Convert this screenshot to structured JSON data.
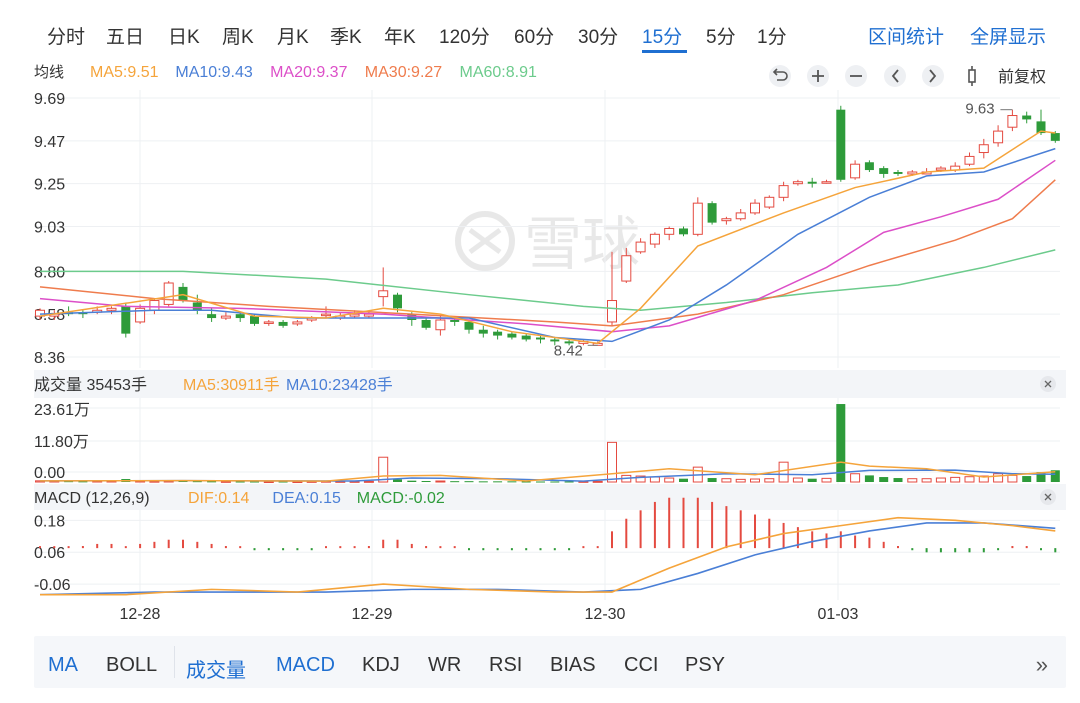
{
  "period_tabs": [
    {
      "label": "分时"
    },
    {
      "label": "五日"
    },
    {
      "label": "日K"
    },
    {
      "label": "周K"
    },
    {
      "label": "月K"
    },
    {
      "label": "季K"
    },
    {
      "label": "年K"
    },
    {
      "label": "120分"
    },
    {
      "label": "60分"
    },
    {
      "label": "30分"
    },
    {
      "label": "15分",
      "active": true
    },
    {
      "label": "5分"
    },
    {
      "label": "1分"
    }
  ],
  "actions": {
    "range_stats": "区间统计",
    "fullscreen": "全屏显示"
  },
  "toolbar": {
    "icons": [
      "undo-icon",
      "zoom-in-icon",
      "zoom-out-icon",
      "prev-icon",
      "next-icon",
      "candle-icon"
    ],
    "adjust_label": "前复权"
  },
  "colors": {
    "up": "#e44a40",
    "down": "#2e9b3a",
    "ma5": "#f5a43b",
    "ma10": "#4a7fd6",
    "ma20": "#dc4fc8",
    "ma30": "#ef7c4d",
    "ma60": "#6ccb8c",
    "accent": "#1f6fd1"
  },
  "chart_data": [
    {
      "type": "candlestick",
      "legend_title": "均线",
      "ma_labels": [
        {
          "text": "MA5:9.51",
          "color": "ma5"
        },
        {
          "text": "MA10:9.43",
          "color": "ma10"
        },
        {
          "text": "MA20:9.37",
          "color": "ma20"
        },
        {
          "text": "MA30:9.27",
          "color": "ma30"
        },
        {
          "text": "MA60:8.91",
          "color": "ma60"
        }
      ],
      "y_ticks": [
        "9.69",
        "9.47",
        "9.25",
        "9.03",
        "8.80",
        "8.58",
        "8.36"
      ],
      "ylim": [
        8.36,
        9.69
      ],
      "x_ticks": [
        "12-28",
        "12-29",
        "12-30",
        "01-03"
      ],
      "high_label": "9.63",
      "low_label": "8.42",
      "candles": [
        [
          8.57,
          8.6,
          8.61,
          8.55
        ],
        [
          8.57,
          8.58,
          8.6,
          8.55
        ],
        [
          8.59,
          8.58,
          8.62,
          8.57
        ],
        [
          8.59,
          8.58,
          8.6,
          8.56
        ],
        [
          8.59,
          8.6,
          8.62,
          8.58
        ],
        [
          8.6,
          8.61,
          8.62,
          8.58
        ],
        [
          8.62,
          8.48,
          8.64,
          8.46
        ],
        [
          8.54,
          8.61,
          8.63,
          8.53
        ],
        [
          8.6,
          8.65,
          8.66,
          8.58
        ],
        [
          8.63,
          8.74,
          8.75,
          8.62
        ],
        [
          8.72,
          8.65,
          8.74,
          8.64
        ],
        [
          8.64,
          8.6,
          8.68,
          8.58
        ],
        [
          8.58,
          8.56,
          8.61,
          8.54
        ],
        [
          8.56,
          8.57,
          8.59,
          8.55
        ],
        [
          8.58,
          8.56,
          8.59,
          8.54
        ],
        [
          8.57,
          8.53,
          8.58,
          8.52
        ],
        [
          8.54,
          8.54,
          8.55,
          8.52
        ],
        [
          8.54,
          8.52,
          8.55,
          8.51
        ],
        [
          8.53,
          8.54,
          8.55,
          8.52
        ],
        [
          8.55,
          8.56,
          8.57,
          8.54
        ],
        [
          8.58,
          8.58,
          8.62,
          8.56
        ],
        [
          8.56,
          8.57,
          8.59,
          8.55
        ],
        [
          8.57,
          8.58,
          8.6,
          8.56
        ],
        [
          8.57,
          8.58,
          8.59,
          8.56
        ],
        [
          8.67,
          8.7,
          8.82,
          8.62
        ],
        [
          8.68,
          8.61,
          8.69,
          8.59
        ],
        [
          8.58,
          8.55,
          8.59,
          8.52
        ],
        [
          8.55,
          8.51,
          8.56,
          8.5
        ],
        [
          8.5,
          8.55,
          8.57,
          8.47
        ],
        [
          8.55,
          8.54,
          8.56,
          8.52
        ],
        [
          8.54,
          8.5,
          8.55,
          8.48
        ],
        [
          8.5,
          8.48,
          8.52,
          8.46
        ],
        [
          8.49,
          8.47,
          8.5,
          8.45
        ],
        [
          8.48,
          8.46,
          8.49,
          8.45
        ],
        [
          8.47,
          8.45,
          8.48,
          8.44
        ],
        [
          8.46,
          8.45,
          8.47,
          8.43
        ],
        [
          8.45,
          8.44,
          8.46,
          8.42
        ],
        [
          8.44,
          8.43,
          8.45,
          8.42
        ],
        [
          8.43,
          8.44,
          8.45,
          8.42
        ],
        [
          8.42,
          8.43,
          8.44,
          8.42
        ],
        [
          8.54,
          8.65,
          8.9,
          8.52
        ],
        [
          8.75,
          8.88,
          8.92,
          8.74
        ],
        [
          8.9,
          8.95,
          8.97,
          8.89
        ],
        [
          8.94,
          8.99,
          9.0,
          8.92
        ],
        [
          8.99,
          9.02,
          9.03,
          8.96
        ],
        [
          9.02,
          8.99,
          9.03,
          8.98
        ],
        [
          8.99,
          9.15,
          9.18,
          8.98
        ],
        [
          9.15,
          9.05,
          9.16,
          9.04
        ],
        [
          9.06,
          9.07,
          9.08,
          9.04
        ],
        [
          9.07,
          9.1,
          9.12,
          9.06
        ],
        [
          9.1,
          9.15,
          9.17,
          9.09
        ],
        [
          9.13,
          9.18,
          9.19,
          9.12
        ],
        [
          9.18,
          9.24,
          9.26,
          9.16
        ],
        [
          9.25,
          9.26,
          9.27,
          9.24
        ],
        [
          9.26,
          9.25,
          9.28,
          9.23
        ],
        [
          9.26,
          9.26,
          9.27,
          9.25
        ],
        [
          9.63,
          9.27,
          9.65,
          9.26
        ],
        [
          9.28,
          9.35,
          9.37,
          9.27
        ],
        [
          9.36,
          9.32,
          9.37,
          9.31
        ],
        [
          9.33,
          9.3,
          9.34,
          9.28
        ],
        [
          9.31,
          9.3,
          9.32,
          9.29
        ],
        [
          9.3,
          9.31,
          9.32,
          9.29
        ],
        [
          9.3,
          9.31,
          9.33,
          9.3
        ],
        [
          9.32,
          9.33,
          9.34,
          9.31
        ],
        [
          9.32,
          9.34,
          9.36,
          9.31
        ],
        [
          9.35,
          9.39,
          9.41,
          9.34
        ],
        [
          9.41,
          9.45,
          9.48,
          9.38
        ],
        [
          9.46,
          9.52,
          9.55,
          9.44
        ],
        [
          9.54,
          9.6,
          9.63,
          9.52
        ],
        [
          9.6,
          9.58,
          9.62,
          9.56
        ],
        [
          9.57,
          9.51,
          9.63,
          9.5
        ],
        [
          9.51,
          9.47,
          9.52,
          9.46
        ]
      ],
      "ma": {
        "ma5": [
          [
            0,
            8.57
          ],
          [
            10,
            8.68
          ],
          [
            15,
            8.57
          ],
          [
            20,
            8.56
          ],
          [
            24,
            8.61
          ],
          [
            28,
            8.58
          ],
          [
            33,
            8.49
          ],
          [
            39,
            8.43
          ],
          [
            42,
            8.61
          ],
          [
            46,
            8.93
          ],
          [
            52,
            9.1
          ],
          [
            57,
            9.23
          ],
          [
            62,
            9.31
          ],
          [
            66,
            9.33
          ],
          [
            70,
            9.52
          ],
          [
            71,
            9.51
          ]
        ],
        "ma10": [
          [
            0,
            8.58
          ],
          [
            8,
            8.6
          ],
          [
            12,
            8.6
          ],
          [
            18,
            8.56
          ],
          [
            24,
            8.56
          ],
          [
            30,
            8.56
          ],
          [
            36,
            8.46
          ],
          [
            40,
            8.44
          ],
          [
            44,
            8.55
          ],
          [
            48,
            8.73
          ],
          [
            53,
            8.99
          ],
          [
            58,
            9.18
          ],
          [
            62,
            9.29
          ],
          [
            66,
            9.31
          ],
          [
            71,
            9.43
          ]
        ],
        "ma20": [
          [
            0,
            8.66
          ],
          [
            6,
            8.62
          ],
          [
            14,
            8.61
          ],
          [
            24,
            8.58
          ],
          [
            34,
            8.53
          ],
          [
            40,
            8.49
          ],
          [
            44,
            8.52
          ],
          [
            50,
            8.65
          ],
          [
            55,
            8.82
          ],
          [
            59,
            9.0
          ],
          [
            63,
            9.08
          ],
          [
            67,
            9.17
          ],
          [
            71,
            9.37
          ]
        ],
        "ma30": [
          [
            0,
            8.72
          ],
          [
            8,
            8.66
          ],
          [
            16,
            8.62
          ],
          [
            26,
            8.58
          ],
          [
            36,
            8.54
          ],
          [
            40,
            8.52
          ],
          [
            46,
            8.58
          ],
          [
            52,
            8.68
          ],
          [
            58,
            8.83
          ],
          [
            64,
            8.96
          ],
          [
            68,
            9.07
          ],
          [
            71,
            9.27
          ]
        ],
        "ma60": [
          [
            0,
            8.8
          ],
          [
            10,
            8.8
          ],
          [
            20,
            8.76
          ],
          [
            30,
            8.68
          ],
          [
            38,
            8.62
          ],
          [
            42,
            8.6
          ],
          [
            48,
            8.64
          ],
          [
            54,
            8.69
          ],
          [
            60,
            8.73
          ],
          [
            66,
            8.82
          ],
          [
            71,
            8.91
          ]
        ]
      }
    },
    {
      "type": "bar",
      "title": "成交量 35453手",
      "ma_labels": [
        {
          "text": "MA5:30911手",
          "color": "ma5"
        },
        {
          "text": "MA10:23428手",
          "color": "ma10"
        }
      ],
      "y_ticks": [
        "23.61万",
        "11.80万",
        "0.00"
      ],
      "ylim": [
        0,
        236100
      ],
      "values": [
        3500,
        4000,
        2500,
        2000,
        3000,
        3500,
        9000,
        3000,
        2500,
        3500,
        3000,
        2500,
        2000,
        2000,
        1500,
        1500,
        1500,
        1500,
        1500,
        2000,
        2500,
        2000,
        2000,
        2000,
        75000,
        8000,
        4000,
        3000,
        3000,
        2500,
        2500,
        2000,
        2000,
        2000,
        1500,
        1500,
        1500,
        1500,
        2000,
        2000,
        120000,
        20000,
        18000,
        15000,
        12000,
        10000,
        45000,
        12000,
        10000,
        8000,
        9000,
        10000,
        60000,
        12000,
        10000,
        11000,
        236000,
        25000,
        20000,
        15000,
        12000,
        10000,
        10000,
        12000,
        14000,
        16000,
        18000,
        25000,
        20000,
        18000,
        30000,
        35453
      ],
      "ma5": [
        [
          0,
          3500
        ],
        [
          10,
          4000
        ],
        [
          20,
          2500
        ],
        [
          24,
          18000
        ],
        [
          28,
          20000
        ],
        [
          34,
          3000
        ],
        [
          40,
          25000
        ],
        [
          44,
          40000
        ],
        [
          50,
          22000
        ],
        [
          56,
          60000
        ],
        [
          58,
          48000
        ],
        [
          62,
          40000
        ],
        [
          66,
          15000
        ],
        [
          71,
          30911
        ]
      ],
      "ma10": [
        [
          0,
          3500
        ],
        [
          10,
          4000
        ],
        [
          22,
          3000
        ],
        [
          26,
          12000
        ],
        [
          32,
          10000
        ],
        [
          38,
          2500
        ],
        [
          42,
          14000
        ],
        [
          48,
          25000
        ],
        [
          54,
          22000
        ],
        [
          58,
          35000
        ],
        [
          64,
          36000
        ],
        [
          68,
          25000
        ],
        [
          71,
          23428
        ]
      ]
    },
    {
      "type": "bar",
      "title": "MACD (12,26,9)",
      "ma_labels": [
        {
          "text": "DIF:0.14",
          "color": "ma5"
        },
        {
          "text": "DEA:0.15",
          "color": "ma10"
        },
        {
          "text": "MACD:-0.02",
          "color": "down"
        }
      ],
      "y_ticks": [
        "0.18",
        "0.06",
        "-0.06"
      ],
      "ylim": [
        -0.12,
        0.2
      ],
      "dif": [
        [
          0,
          -0.1
        ],
        [
          6,
          -0.1
        ],
        [
          12,
          -0.08
        ],
        [
          18,
          -0.09
        ],
        [
          24,
          -0.06
        ],
        [
          30,
          -0.08
        ],
        [
          36,
          -0.09
        ],
        [
          40,
          -0.09
        ],
        [
          44,
          0.0
        ],
        [
          48,
          0.08
        ],
        [
          52,
          0.13
        ],
        [
          56,
          0.16
        ],
        [
          60,
          0.19
        ],
        [
          64,
          0.18
        ],
        [
          68,
          0.16
        ],
        [
          71,
          0.14
        ]
      ],
      "dea": [
        [
          0,
          -0.1
        ],
        [
          8,
          -0.09
        ],
        [
          14,
          -0.09
        ],
        [
          20,
          -0.09
        ],
        [
          26,
          -0.08
        ],
        [
          32,
          -0.08
        ],
        [
          38,
          -0.09
        ],
        [
          42,
          -0.08
        ],
        [
          46,
          -0.02
        ],
        [
          50,
          0.05
        ],
        [
          54,
          0.1
        ],
        [
          58,
          0.14
        ],
        [
          62,
          0.17
        ],
        [
          66,
          0.17
        ],
        [
          71,
          0.15
        ]
      ],
      "macd": [
        0.0,
        0.0,
        0.0,
        0.005,
        0.01,
        0.01,
        0.0,
        0.01,
        0.015,
        0.02,
        0.02,
        0.015,
        0.01,
        0.005,
        0.0,
        -0.005,
        -0.005,
        -0.005,
        -0.005,
        -0.005,
        0.0,
        0.0,
        0.0,
        0.005,
        0.02,
        0.02,
        0.01,
        0.005,
        0.0,
        0.0,
        -0.005,
        -0.005,
        -0.005,
        -0.005,
        -0.005,
        -0.005,
        -0.005,
        -0.005,
        0.0,
        0.0,
        0.04,
        0.07,
        0.09,
        0.11,
        0.12,
        0.12,
        0.12,
        0.11,
        0.1,
        0.09,
        0.08,
        0.07,
        0.06,
        0.05,
        0.04,
        0.035,
        0.04,
        0.03,
        0.025,
        0.015,
        0.005,
        -0.005,
        -0.01,
        -0.01,
        -0.01,
        -0.01,
        -0.01,
        -0.005,
        0.005,
        0.005,
        -0.005,
        -0.01
      ]
    }
  ],
  "indicator_tabs": [
    {
      "label": "MA",
      "style": "blue"
    },
    {
      "label": "BOLL",
      "style": "dark"
    },
    {
      "label": "成交量",
      "style": "blue"
    },
    {
      "label": "MACD",
      "style": "blue"
    },
    {
      "label": "KDJ",
      "style": "dark"
    },
    {
      "label": "WR",
      "style": "dark"
    },
    {
      "label": "RSI",
      "style": "dark"
    },
    {
      "label": "BIAS",
      "style": "dark"
    },
    {
      "label": "CCI",
      "style": "dark"
    },
    {
      "label": "PSY",
      "style": "dark"
    }
  ],
  "more_label": "»",
  "watermark": "雪球"
}
